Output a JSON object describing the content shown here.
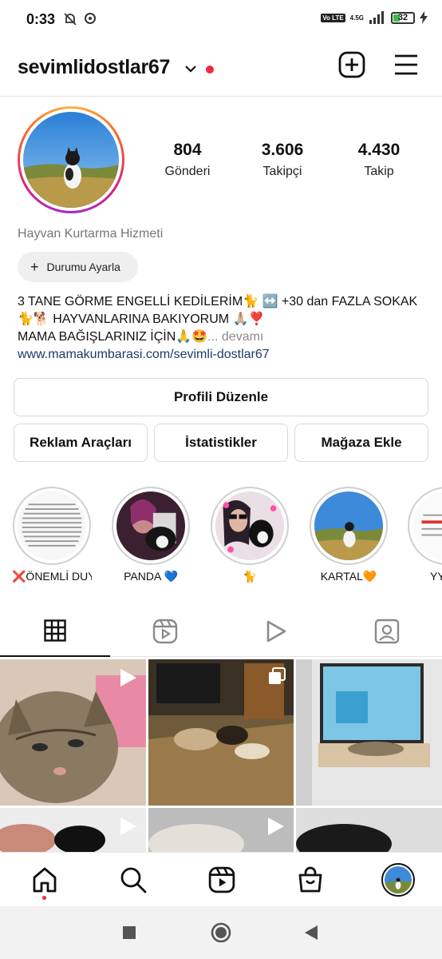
{
  "status_bar": {
    "time": "0:33",
    "volte": "Vo LTE",
    "network": "4.5G",
    "battery": "32",
    "battery_fraction": 0.32
  },
  "header": {
    "username": "sevimlidostlar67"
  },
  "profile": {
    "stats": [
      {
        "value": "804",
        "label": "Gönderi"
      },
      {
        "value": "3.606",
        "label": "Takipçi"
      },
      {
        "value": "4.430",
        "label": "Takip"
      }
    ],
    "category": "Hayvan Kurtarma Hizmeti",
    "status_button": "Durumu Ayarla",
    "bio_line1": "3 TANE GÖRME ENGELLİ KEDİLERİM🐈 ↔️ +30 dan FAZLA SOKAK",
    "bio_line2": "🐈🐕 HAYVANLARINA BAKIYORUM 🙏🏼❣️",
    "bio_line3": "MAMA BAĞIŞLARINIZ İÇİN🙏🤩",
    "bio_more": "... devamı",
    "link": "www.mamakumbarasi.com/sevimli-dostlar67"
  },
  "buttons": {
    "edit_profile": "Profili Düzenle",
    "ad_tools": "Reklam Araçları",
    "insights": "İstatistikler",
    "add_shop": "Mağaza Ekle"
  },
  "highlights": [
    {
      "label": "❌ÖNEMLİ DUY..."
    },
    {
      "label": "PANDA 💙"
    },
    {
      "label": "🐈"
    },
    {
      "label": "KARTAL🧡"
    },
    {
      "label": "YY"
    }
  ],
  "icons": {
    "header": [
      "chevron-down-icon",
      "new-post-icon",
      "menu-icon"
    ],
    "tabs": [
      "grid-icon",
      "reels-icon",
      "video-play-icon",
      "tagged-icon"
    ],
    "bottom_nav": [
      "home-icon",
      "search-icon",
      "reels-icon",
      "shop-icon",
      "profile-avatar"
    ],
    "system": [
      "recents-icon",
      "home-circle-icon",
      "back-icon"
    ]
  },
  "colors": {
    "notification_dot": "#ef2a3f",
    "link": "#1d3b67",
    "battery_fill": "#3dbd4a"
  }
}
